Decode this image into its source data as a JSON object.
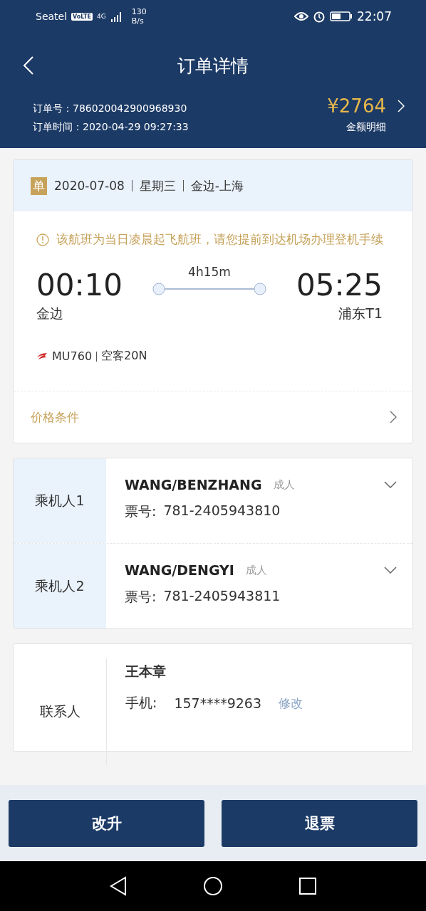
{
  "status_bar": {
    "carrier": "Seatel",
    "volte": "VoLTE",
    "network": "4G",
    "speed": "130",
    "speed_unit": "B/s",
    "time": "22:07"
  },
  "nav": {
    "title": "订单详情"
  },
  "order": {
    "price": "¥2764",
    "price_detail": "金额明细",
    "number_label": "订单号：",
    "number": "786020042900968930",
    "time_label": "订单时间：",
    "time": "2020-04-29 09:27:33"
  },
  "flight": {
    "badge": "单",
    "date": "2020-07-08",
    "weekday": "星期三",
    "route": "金边-上海",
    "notice": "该航班为当日凌晨起飞航班，请您提前到达机场办理登机手续",
    "depart_time": "00:10",
    "depart_airport": "金边",
    "duration": "4h15m",
    "arrive_time": "05:25",
    "arrive_airport": "浦东T1",
    "flight_no": "MU760",
    "aircraft": "空客20N",
    "price_rules": "价格条件"
  },
  "passengers": [
    {
      "label": "乘机人1",
      "name": "WANG/BENZHANG",
      "type": "成人",
      "ticket_label": "票号:",
      "ticket": "781-2405943810",
      "expanded": false
    },
    {
      "label": "乘机人2",
      "name": "WANG/DENGYI",
      "type": "成人",
      "ticket_label": "票号:",
      "ticket": "781-2405943811",
      "expanded": false
    }
  ],
  "contact": {
    "label": "联系人",
    "name": "王本章",
    "phone_label": "手机:",
    "phone": "157****9263",
    "edit": "修改"
  },
  "buttons": [
    "改升",
    "退票"
  ]
}
